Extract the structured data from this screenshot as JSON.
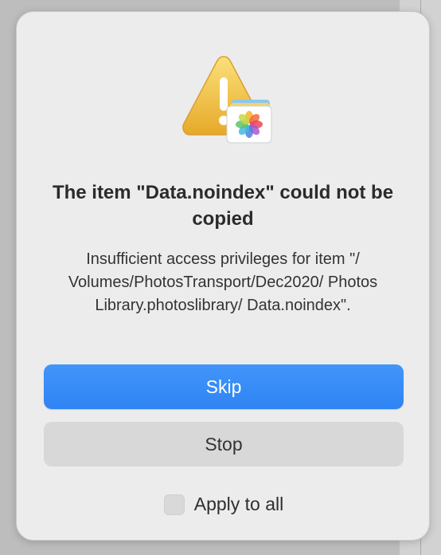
{
  "dialog": {
    "icon": "warning-icon",
    "badge_icon": "photos-icon",
    "title": "The item \"Data.noindex\" could not be copied",
    "message": "Insufficient access privileges for item \"/ Volumes/PhotosTransport/Dec2020/ Photos Library.photoslibrary/ Data.noindex\".",
    "skip_label": "Skip",
    "stop_label": "Stop",
    "apply_to_all_label": "Apply to all",
    "apply_to_all_checked": false
  },
  "colors": {
    "primary_button": "#3b8ef7",
    "secondary_button": "#d8d8d8",
    "warning_triangle": "#f3c53b"
  }
}
